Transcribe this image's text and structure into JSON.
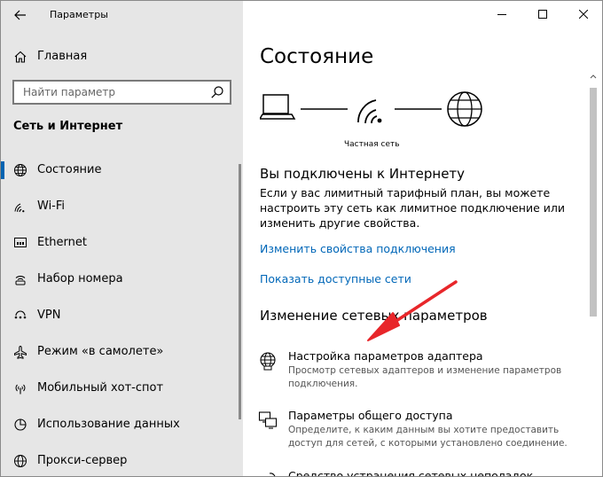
{
  "window": {
    "title": "Параметры"
  },
  "sidebar": {
    "home_label": "Главная",
    "search_placeholder": "Найти параметр",
    "section_title": "Сеть и Интернет",
    "items": [
      {
        "label": "Состояние",
        "icon": "globe-network-icon",
        "active": true
      },
      {
        "label": "Wi-Fi",
        "icon": "wifi-icon"
      },
      {
        "label": "Ethernet",
        "icon": "ethernet-icon"
      },
      {
        "label": "Набор номера",
        "icon": "dialup-icon"
      },
      {
        "label": "VPN",
        "icon": "vpn-icon"
      },
      {
        "label": "Режим «в самолете»",
        "icon": "airplane-icon"
      },
      {
        "label": "Мобильный хот-спот",
        "icon": "hotspot-icon"
      },
      {
        "label": "Использование данных",
        "icon": "data-usage-icon"
      },
      {
        "label": "Прокси-сервер",
        "icon": "proxy-globe-icon"
      }
    ]
  },
  "main": {
    "title": "Состояние",
    "network_label": "Частная сеть",
    "connected_title": "Вы подключены к Интернету",
    "connected_desc": "Если у вас лимитный тарифный план, вы можете настроить эту сеть как лимитное подключение или изменить другие свойства.",
    "link_properties": "Изменить свойства подключения",
    "link_networks": "Показать доступные сети",
    "change_title": "Изменение сетевых параметров",
    "options": [
      {
        "title": "Настройка параметров адаптера",
        "desc": "Просмотр сетевых адаптеров и изменение параметров подключения.",
        "icon": "adapter-globe-icon"
      },
      {
        "title": "Параметры общего доступа",
        "desc": "Определите, к каким данным вы хотите предоставить доступ для сетей, с которыми установлено соединение.",
        "icon": "sharing-icon"
      },
      {
        "title": "Средство устранения сетевых неполадок",
        "icon": "troubleshoot-icon"
      }
    ]
  },
  "colors": {
    "sidebar_bg": "#e6e6e6",
    "accent": "#0063b1",
    "link": "#0067b8",
    "annotation_arrow": "#e8262a"
  }
}
